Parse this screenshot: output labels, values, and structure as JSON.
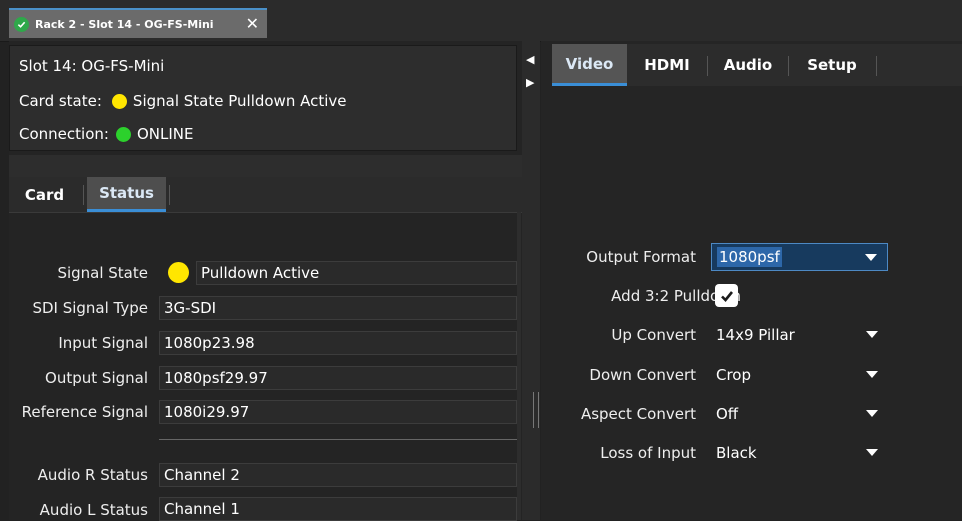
{
  "window_tab": {
    "title": "Rack 2 - Slot 14 - OG-FS-Mini",
    "close": "✕"
  },
  "info": {
    "slot": "Slot 14: OG-FS-Mini",
    "card_state_label": "Card state:",
    "card_state_value": "Signal State Pulldown Active",
    "connection_label": "Connection:",
    "connection_value": "ONLINE"
  },
  "left_tabs": [
    "Card",
    "Status"
  ],
  "status": {
    "signal_state_label": "Signal State",
    "signal_state_value": "Pulldown Active",
    "sdi_type_label": "SDI Signal Type",
    "sdi_type_value": "3G-SDI",
    "input_label": "Input Signal",
    "input_value": "1080p23.98",
    "output_label": "Output Signal",
    "output_value": "1080psf29.97",
    "reference_label": "Reference Signal",
    "reference_value": "1080i29.97",
    "audio_r_label": "Audio R Status",
    "audio_r_value": "Channel 2",
    "audio_l_label": "Audio L Status",
    "audio_l_value": "Channel 1"
  },
  "right_tabs": [
    "Video",
    "HDMI",
    "Audio",
    "Setup"
  ],
  "video": {
    "output_format_label": "Output Format",
    "output_format_value": "1080psf",
    "pulldown_label": "Add 3:2 Pulldown",
    "pulldown_checked": true,
    "up_convert_label": "Up Convert",
    "up_convert_value": "14x9 Pillar",
    "down_convert_label": "Down Convert",
    "down_convert_value": "Crop",
    "aspect_convert_label": "Aspect Convert",
    "aspect_convert_value": "Off",
    "loss_input_label": "Loss of Input",
    "loss_input_value": "Black"
  },
  "colors": {
    "accent": "#3a8ed6",
    "led_yellow": "#ffe600",
    "led_green": "#2cd12c",
    "status_ok": "#2ea84a"
  },
  "icons": {
    "tab_status": "check-circle-icon",
    "close": "close-icon",
    "left_arrow": "arrow-left-icon",
    "right_arrow": "arrow-right-icon"
  }
}
